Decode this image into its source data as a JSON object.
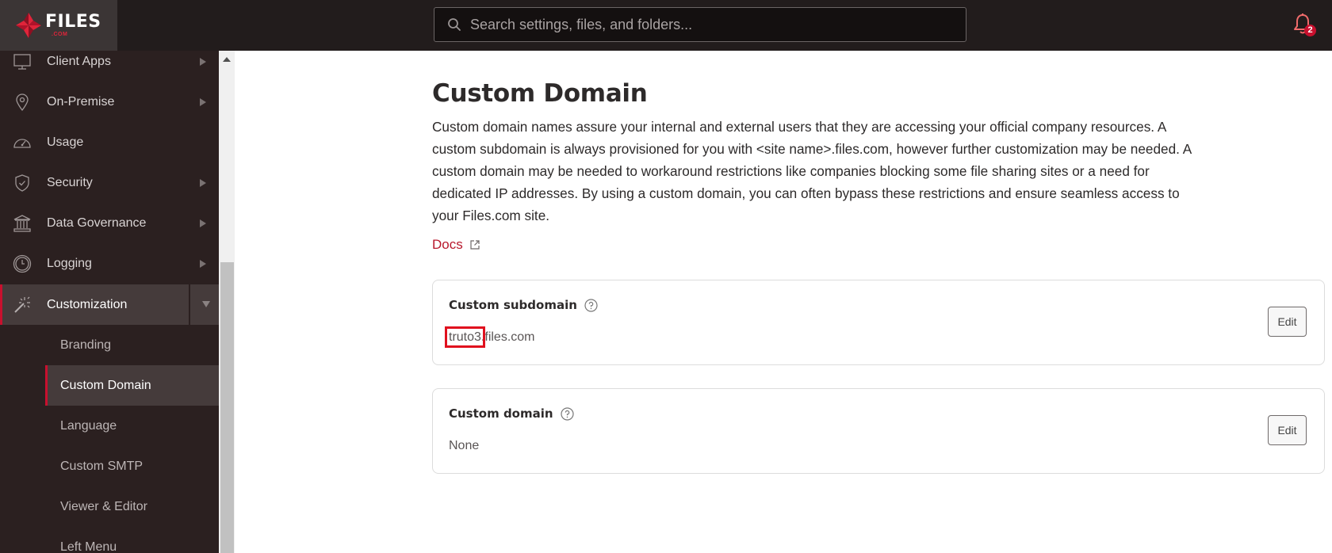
{
  "header": {
    "logo": {
      "word": "FILES",
      "sub": ".COM"
    },
    "search": {
      "placeholder": "Search settings, files, and folders...",
      "value": ""
    },
    "notifications": {
      "count": "2"
    }
  },
  "sidebar": {
    "items": [
      {
        "label": "Client Apps",
        "icon": "monitor-icon",
        "has_children": true
      },
      {
        "label": "On-Premise",
        "icon": "map-pin-icon",
        "has_children": true
      },
      {
        "label": "Usage",
        "icon": "speedometer-icon",
        "has_children": false
      },
      {
        "label": "Security",
        "icon": "shield-check-icon",
        "has_children": true
      },
      {
        "label": "Data Governance",
        "icon": "bank-icon",
        "has_children": true
      },
      {
        "label": "Logging",
        "icon": "clock-icon",
        "has_children": true
      },
      {
        "label": "Customization",
        "icon": "magic-wand-icon",
        "has_children": true,
        "expanded": true
      }
    ],
    "sub_items": [
      {
        "label": "Branding"
      },
      {
        "label": "Custom Domain",
        "active": true
      },
      {
        "label": "Language"
      },
      {
        "label": "Custom SMTP"
      },
      {
        "label": "Viewer & Editor"
      },
      {
        "label": "Left Menu"
      }
    ]
  },
  "main": {
    "title": "Custom Domain",
    "description": "Custom domain names assure your internal and external users that they are accessing your official company resources. A custom subdomain is always provisioned for you with <site name>.files.com, however further customization may be needed. A custom domain may be needed to workaround restrictions like companies blocking some file sharing sites or a need for dedicated IP addresses. By using a custom domain, you can often bypass these restrictions and ensure seamless access to your Files.com site.",
    "docs_link": "Docs",
    "cards": [
      {
        "title": "Custom subdomain",
        "value_highlight": "truto3",
        "value_rest": ".files.com",
        "edit_label": "Edit"
      },
      {
        "title": "Custom domain",
        "value": "None",
        "edit_label": "Edit"
      }
    ]
  },
  "colors": {
    "accent": "#c8102e",
    "header_bg": "#221c1c",
    "sidebar_bg": "#2b2020",
    "active_bg": "#453b3b",
    "link": "#b8182c"
  }
}
